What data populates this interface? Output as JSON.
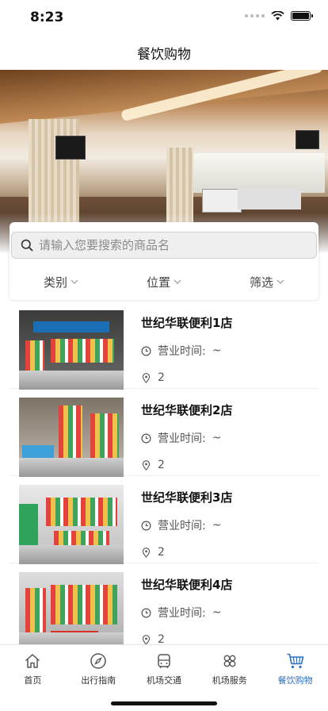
{
  "status_bar": {
    "time": "8:23"
  },
  "nav": {
    "title": "餐饮购物"
  },
  "search": {
    "placeholder": "请输入您要搜索的商品名"
  },
  "filters": [
    {
      "label": "类别"
    },
    {
      "label": "位置"
    },
    {
      "label": "筛选"
    }
  ],
  "stores": [
    {
      "name": "世纪华联便利1店",
      "hours_label": "营业时间:",
      "hours_value": "~",
      "location": "2"
    },
    {
      "name": "世纪华联便利2店",
      "hours_label": "营业时间:",
      "hours_value": "~",
      "location": "2"
    },
    {
      "name": "世纪华联便利3店",
      "hours_label": "营业时间:",
      "hours_value": "~",
      "location": "2"
    },
    {
      "name": "世纪华联便利4店",
      "hours_label": "营业时间:",
      "hours_value": "~",
      "location": "2"
    }
  ],
  "tabs": [
    {
      "label": "首页",
      "icon": "home-icon"
    },
    {
      "label": "出行指南",
      "icon": "compass-icon"
    },
    {
      "label": "机场交通",
      "icon": "bus-icon"
    },
    {
      "label": "机场服务",
      "icon": "services-icon"
    },
    {
      "label": "餐饮购物",
      "icon": "cart-icon",
      "active": true
    }
  ],
  "colors": {
    "accent": "#2f6fc2",
    "text": "#222222",
    "muted": "#8a8a8a"
  }
}
